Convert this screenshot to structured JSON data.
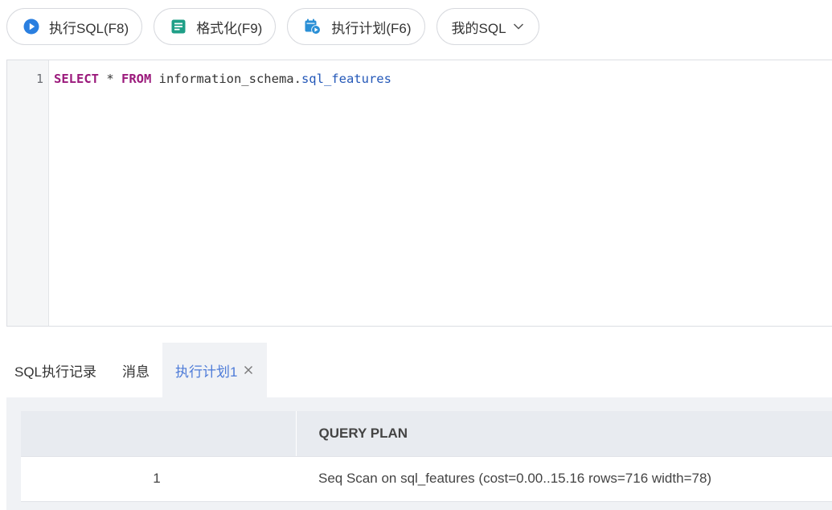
{
  "toolbar": {
    "run_sql": "执行SQL(F8)",
    "format": "格式化(F9)",
    "explain": "执行计划(F6)",
    "my_sql": "我的SQL",
    "icons": {
      "run": "play-circle-icon",
      "format": "document-lines-icon",
      "explain": "plan-calendar-icon",
      "dropdown": "chevron-down-icon"
    }
  },
  "editor": {
    "line_number": "1",
    "tokens": {
      "select": "SELECT",
      "star": " * ",
      "from": "FROM",
      "schema": " information_schema.",
      "table": "sql_features"
    }
  },
  "tabs": {
    "history": "SQL执行记录",
    "messages": "消息",
    "plan": "执行计划1"
  },
  "result": {
    "columns": [
      "",
      "QUERY PLAN"
    ],
    "rows": [
      {
        "index": "1",
        "plan": "Seq Scan on sql_features  (cost=0.00..15.16 rows=716 width=78)"
      }
    ]
  },
  "colors": {
    "accent": "#4d7bd8",
    "keyword": "#9b1a7c",
    "property": "#2458b8",
    "format_icon": "#1f9f87",
    "explain_icon": "#2a8fd6"
  }
}
